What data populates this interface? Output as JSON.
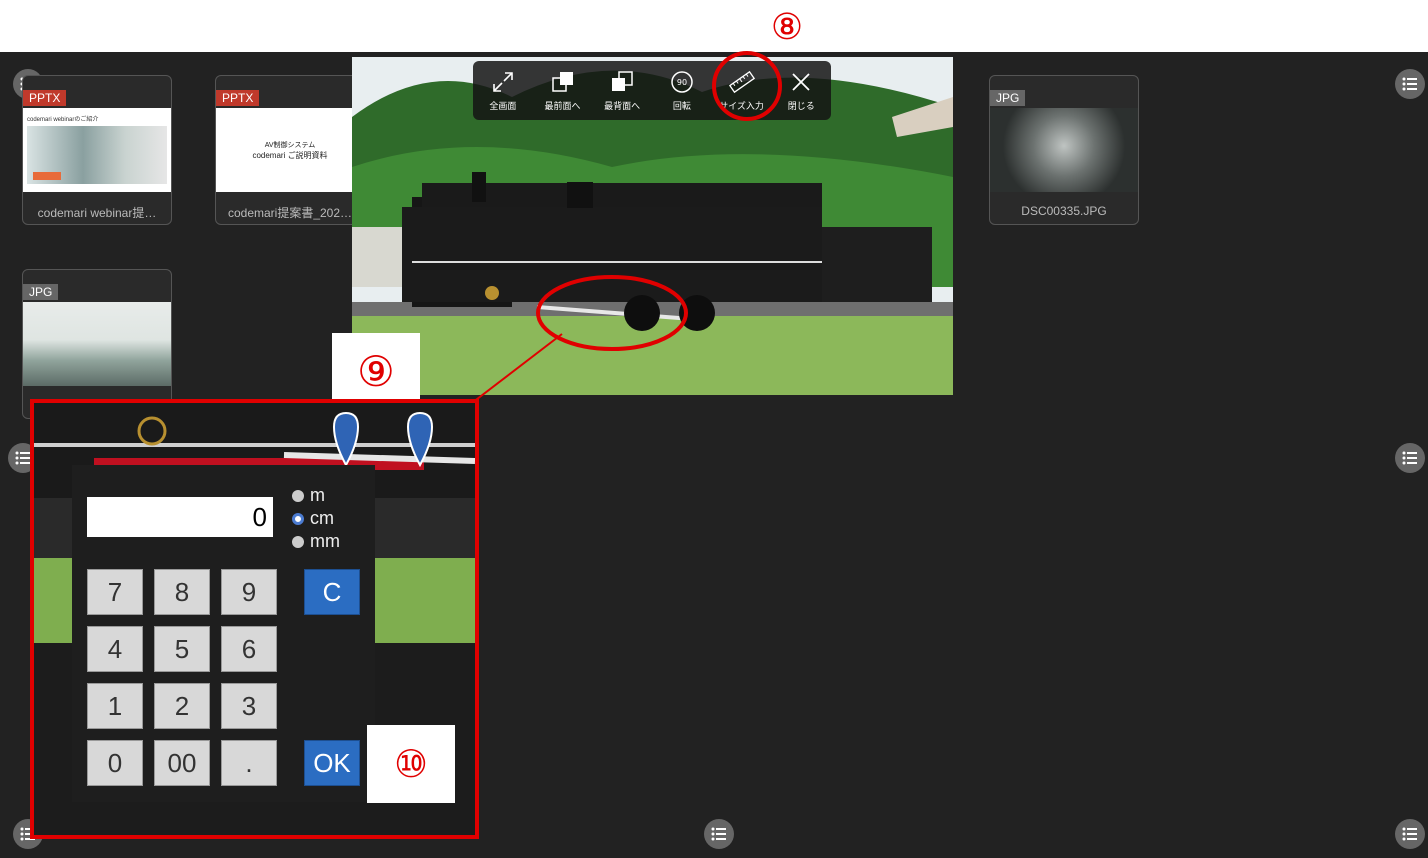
{
  "annotations": {
    "n8": "⑧",
    "n9": "⑨",
    "n10": "⑩"
  },
  "cards": [
    {
      "tag": "PPTX",
      "caption": "codemari webinar提…",
      "thumb_title": "codemari webinarのご紹介"
    },
    {
      "tag": "PPTX",
      "caption": "codemari提案書_202…",
      "thumb_title1": "AV制御システム",
      "thumb_title2": "codemari ご説明資料"
    },
    {
      "tag": "JPG",
      "caption": "DSC00335.JPG"
    },
    {
      "tag": "JPG",
      "caption": ""
    }
  ],
  "toolbar": {
    "fullscreen": "全画面",
    "front": "最前面へ",
    "back": "最背面へ",
    "rotate": "回転",
    "rotate_icon_text": "90",
    "size_input": "サイズ入力",
    "close": "閉じる"
  },
  "calculator": {
    "value": "0",
    "units": [
      "m",
      "cm",
      "mm"
    ],
    "selected_unit": "cm",
    "keys": [
      "7",
      "8",
      "9",
      "4",
      "5",
      "6",
      "1",
      "2",
      "3",
      "0",
      "00",
      "."
    ],
    "clear": "C",
    "ok": "OK"
  },
  "colors": {
    "accent_red": "#e00000",
    "tag_red": "#c0392b",
    "tag_gray": "#666666",
    "key_blue": "#2b6dc2"
  }
}
